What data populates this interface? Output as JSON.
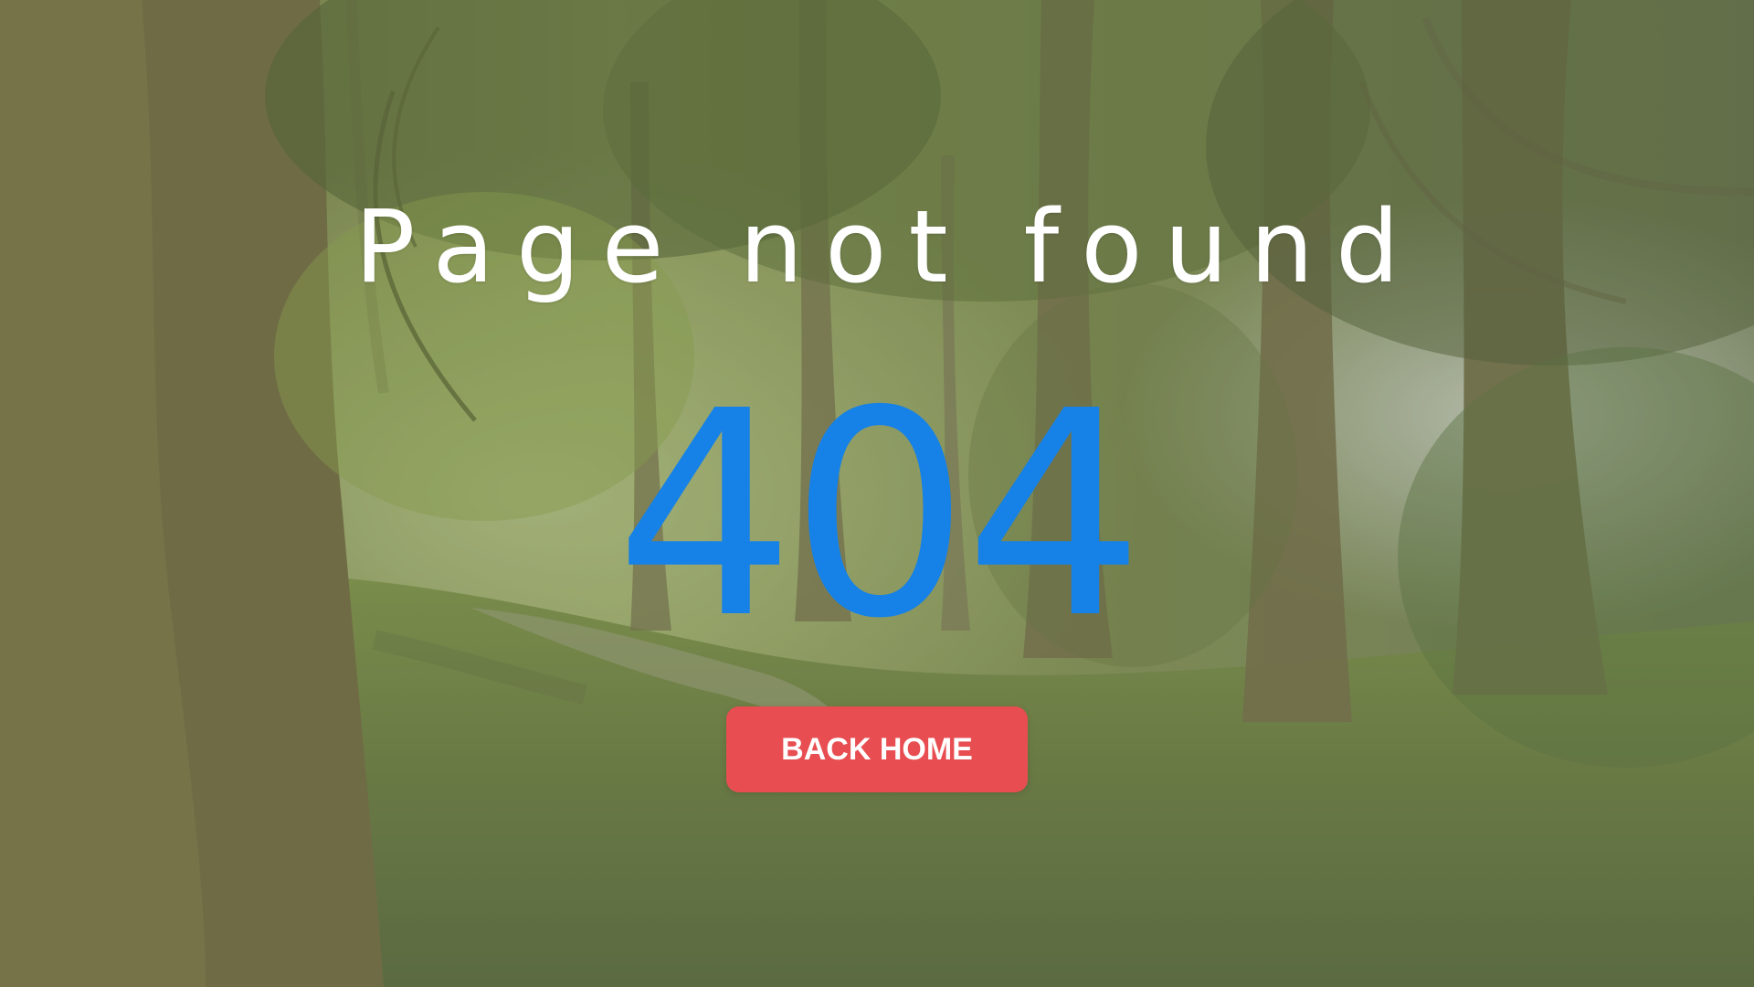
{
  "page": {
    "title": "Page not found",
    "error_code": "404",
    "back_button_label": "BACK HOME"
  },
  "colors": {
    "title": "#ffffff",
    "error_code": "#1681e6",
    "button_background": "#e84e51",
    "button_text": "#ffffff"
  },
  "background": {
    "description_icon": "forest-path-photo"
  }
}
